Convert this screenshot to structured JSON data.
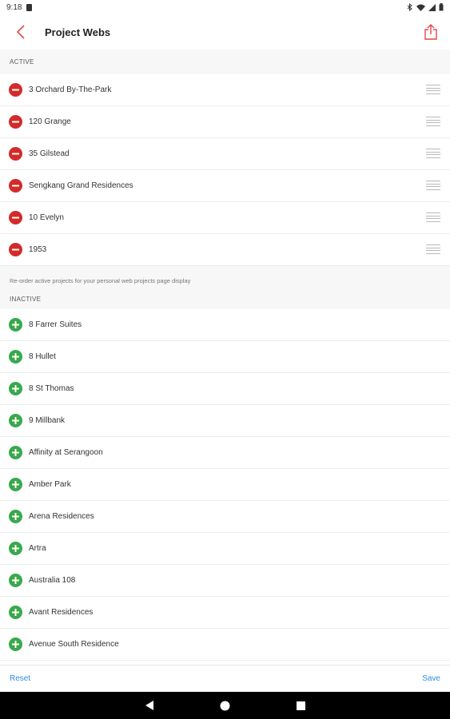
{
  "status_bar": {
    "time": "9:18"
  },
  "header": {
    "title": "Project Webs",
    "back_icon": "chevron-left-icon",
    "share_icon": "share-icon"
  },
  "active": {
    "header": "ACTIVE",
    "items": [
      {
        "label": "3 Orchard By-The-Park"
      },
      {
        "label": "120 Grange"
      },
      {
        "label": "35 Gilstead"
      },
      {
        "label": "Sengkang Grand Residences"
      },
      {
        "label": "10 Evelyn"
      },
      {
        "label": "1953"
      }
    ]
  },
  "hint": "Re-order active projects for your personal web projects page display",
  "inactive": {
    "header": "INACTIVE",
    "items": [
      {
        "label": "8 Farrer Suites"
      },
      {
        "label": "8 Hullet"
      },
      {
        "label": "8 St Thomas"
      },
      {
        "label": "9 Millbank"
      },
      {
        "label": "Affinity at Serangoon"
      },
      {
        "label": "Amber Park"
      },
      {
        "label": "Arena Residences"
      },
      {
        "label": "Artra"
      },
      {
        "label": "Australia 108"
      },
      {
        "label": "Avant Residences"
      },
      {
        "label": "Avenue South Residence"
      }
    ]
  },
  "footer": {
    "reset_label": "Reset",
    "save_label": "Save"
  },
  "colors": {
    "accent": "#e04848",
    "remove": "#d42a2a",
    "add": "#38a94a",
    "link": "#2f8de4"
  }
}
